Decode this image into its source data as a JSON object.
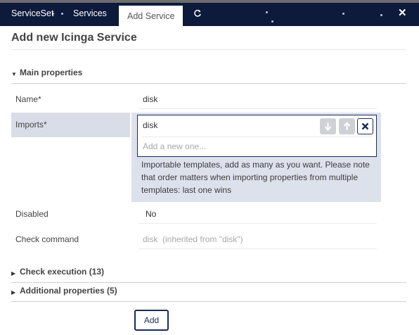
{
  "tabs": [
    {
      "label": "ServiceSet"
    },
    {
      "label": "Services"
    },
    {
      "label": "Add Service"
    }
  ],
  "icons": {
    "refresh": "refresh-icon",
    "close": "close-icon",
    "collapse": "caret-down-icon",
    "expand": "caret-right-icon",
    "move_down": "arrow-down-icon",
    "move_up": "arrow-up-icon",
    "remove": "x-icon"
  },
  "colors": {
    "topbar": "#0d1a3c",
    "accent": "#1a2b57",
    "highlight": "#d9dde8"
  },
  "page_title": "Add new Icinga Service",
  "sections": {
    "main": "Main properties",
    "check_execution": "Check execution (13)",
    "additional": "Additional properties (5)"
  },
  "fields": {
    "name": {
      "label": "Name*",
      "value": "disk"
    },
    "imports": {
      "label": "Imports*",
      "value": "disk",
      "placeholder": "Add a new one...",
      "hint": "Importable templates, add as many as you want. Please note that order matters when importing properties from multiple templates: last one wins"
    },
    "disabled": {
      "label": "Disabled",
      "value": "No"
    },
    "check_command": {
      "label": "Check command",
      "value": "disk",
      "inherited": "(inherited from \"disk\")"
    }
  },
  "submit_label": "Add"
}
